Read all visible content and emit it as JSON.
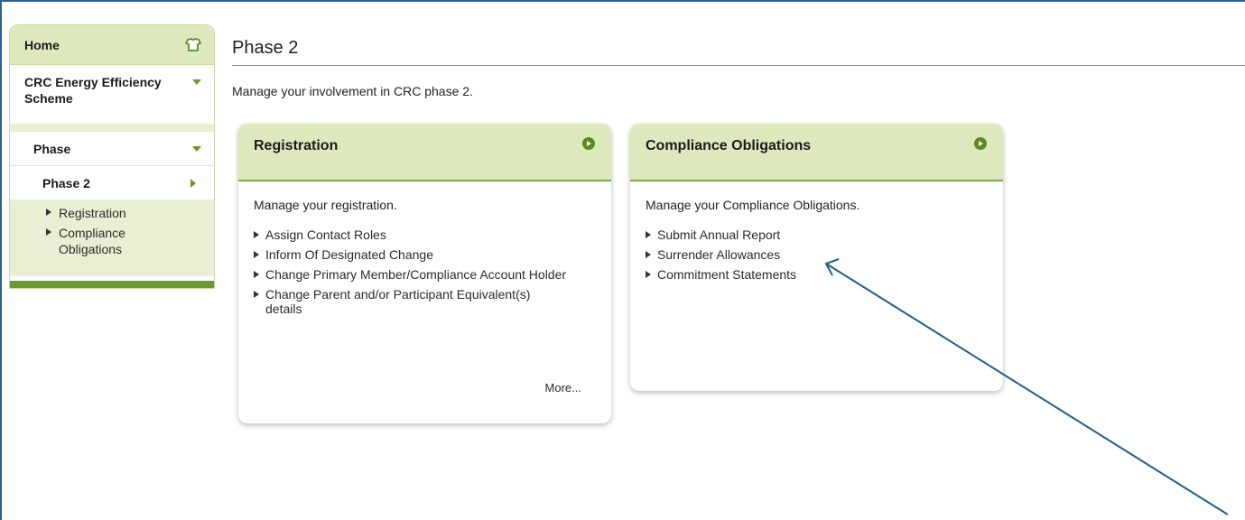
{
  "sidebar": {
    "home": {
      "label": "Home",
      "icon": "home-icon"
    },
    "scheme": {
      "label": "CRC Energy Efficiency Scheme"
    },
    "phase": {
      "label": "Phase"
    },
    "phase2": {
      "label": "Phase 2"
    },
    "links": [
      {
        "label": "Registration"
      },
      {
        "label": "Compliance Obligations"
      }
    ]
  },
  "main": {
    "title": "Phase 2",
    "intro": "Manage your involvement in CRC phase 2.",
    "cards": [
      {
        "title": "Registration",
        "description": "Manage your registration.",
        "links": [
          "Assign Contact Roles",
          "Inform Of Designated Change",
          "Change Primary Member/Compliance Account Holder",
          "Change Parent and/or Participant Equivalent(s) details"
        ],
        "more": "More..."
      },
      {
        "title": "Compliance Obligations",
        "description": "Manage your Compliance Obligations.",
        "links": [
          "Submit Annual Report",
          "Surrender Allowances",
          "Commitment Statements"
        ]
      }
    ]
  },
  "colors": {
    "accent": "#7fa64a",
    "header_bg": "#dde9bd",
    "annotation": "#1f5f8b"
  }
}
